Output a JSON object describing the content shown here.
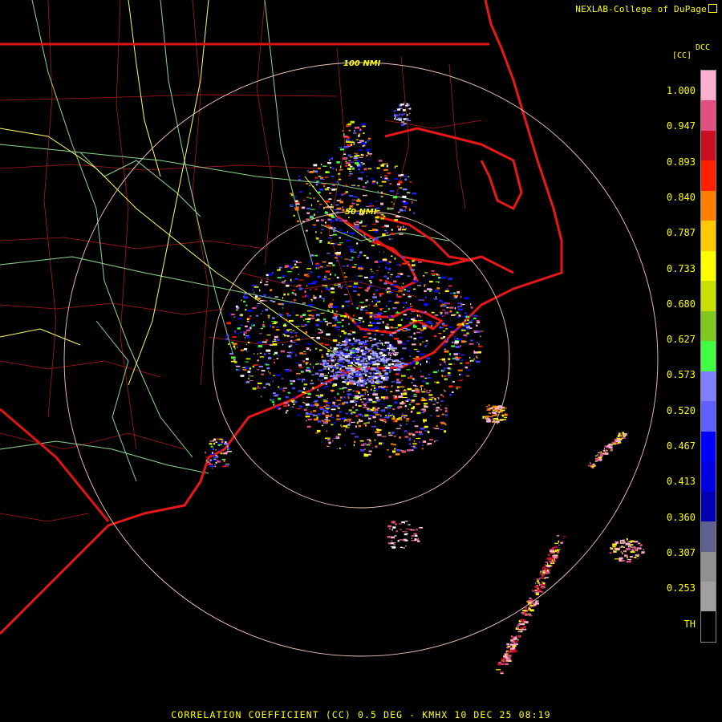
{
  "credit": "NEXLAB-College of DuPage",
  "scale": {
    "code": "DCC",
    "unit": "[CC]",
    "ticks": [
      "1.000",
      "0.947",
      "0.893",
      "0.840",
      "0.787",
      "0.733",
      "0.680",
      "0.627",
      "0.573",
      "0.520",
      "0.467",
      "0.413",
      "0.360",
      "0.307",
      "0.253",
      "TH"
    ],
    "colors": [
      "#ffb0d0",
      "#e05080",
      "#c81020",
      "#ff2000",
      "#ff8000",
      "#ffc800",
      "#ffff00",
      "#c8e000",
      "#80c820",
      "#40ff40",
      "#8080ff",
      "#6060ff",
      "#0000ff",
      "#0000e0",
      "#0000b0",
      "#606090",
      "#909090",
      "#a0a0a0",
      "#000000"
    ]
  },
  "rings": {
    "outer_label": "100 NMI",
    "inner_label": "50 NMI"
  },
  "title": "CORRELATION COEFFICIENT (CC) 0.5 DEG - KMHX 10 DEC 25 08:19"
}
